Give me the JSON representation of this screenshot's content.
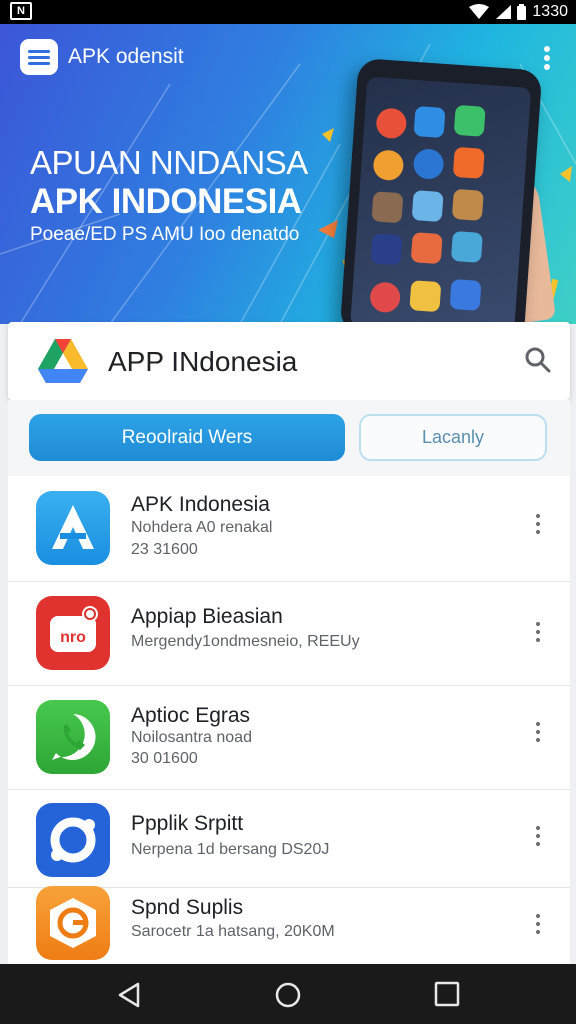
{
  "status_bar": {
    "time": "1330",
    "icons": [
      "notification-icon",
      "wifi-icon",
      "signal-icon",
      "battery-icon"
    ]
  },
  "hero": {
    "app_title": "APK odensit",
    "line1": "APUAN NNDANSA",
    "line2": "APK INDONESIA",
    "subtitle": "Poeae/ED PS AMU Ioo denatdo"
  },
  "search": {
    "title": "APP INdonesia"
  },
  "tabs": [
    {
      "label": "Reoolraid Wers",
      "active": true
    },
    {
      "label": "Lacanly",
      "active": false
    }
  ],
  "apps": [
    {
      "title": "APK Indonesia",
      "line1": "Nohdera A0 renakal",
      "line2": "23 31600",
      "icon": "apk-store-icon",
      "color": "#1f9ee8"
    },
    {
      "title": "Appiap Bieasian",
      "line1": "Mergendy1ondmesneio, REEUy",
      "line2": "",
      "icon": "calendar-badge-icon",
      "color": "#e0322e"
    },
    {
      "title": "Aptioc Egras",
      "line1": "Noilosantra noad",
      "line2": "30 01600",
      "icon": "phone-call-icon",
      "color": "#36b53e"
    },
    {
      "title": "Ppplik Srpitt",
      "line1": "Nerpena 1d bersang DS20J",
      "line2": "",
      "icon": "ring-icon",
      "color": "#2563d8"
    },
    {
      "title": "Spnd Suplis",
      "line1": "Sarocetr 1a hatsang, 20K0M",
      "line2": "",
      "icon": "g-badge-icon",
      "color": "#f28a1c"
    }
  ],
  "colors": {
    "accent": "#1f8bd6",
    "hero_start": "#3c56d8",
    "hero_end": "#3fd0c6"
  }
}
